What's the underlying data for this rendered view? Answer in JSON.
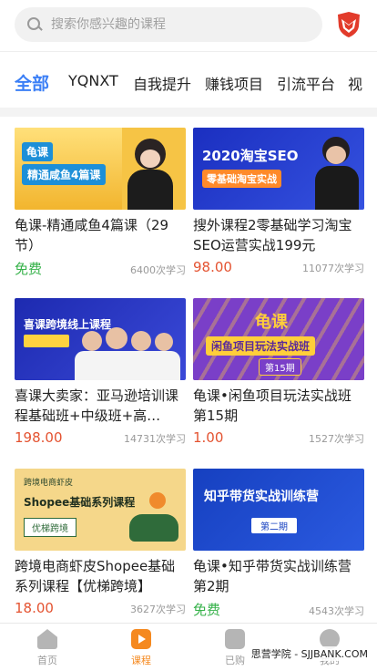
{
  "search": {
    "placeholder": "搜索你感兴趣的课程"
  },
  "tabs": [
    {
      "label": "全部"
    },
    {
      "label": "YQNXT"
    },
    {
      "label": "自我提升"
    },
    {
      "label": "赚钱项目"
    },
    {
      "label": "引流平台"
    },
    {
      "label": "视"
    }
  ],
  "courses": [
    {
      "title": "龟课-精通咸鱼4篇课（29节）",
      "price": "免费",
      "learners": "6400次学习",
      "thumb": {
        "text": "精通咸鱼4篇课",
        "tag": "龟课",
        "bg": "#f6c445",
        "accent": "#1d8fd8"
      }
    },
    {
      "title": "搜外课程2零基础学习淘宝SEO运营实战199元",
      "price": "98.00",
      "learners": "11077次学习",
      "thumb": {
        "text": "2020淘宝SEO",
        "sub": "零基础淘宝实战",
        "bg": "#1a3fc6",
        "accent": "#ff8a2a"
      }
    },
    {
      "title": "喜课大卖家：亚马逊培训课程基础班+中级班+高…",
      "price": "198.00",
      "learners": "14731次学习",
      "thumb": {
        "text": "喜课跨境线上课程",
        "bg": "#2430b8",
        "accent": "#ffd23f"
      }
    },
    {
      "title": "龟课•闲鱼项目玩法实战班第15期",
      "price": "1.00",
      "learners": "1527次学习",
      "thumb": {
        "text": "龟课",
        "sub": "闲鱼项目玩法实战班",
        "tag": "第15期",
        "bg": "#7a3fc8",
        "accent": "#ffce3a"
      }
    },
    {
      "title": "跨境电商虾皮Shopee基础系列课程【优梯跨境】",
      "price": "18.00",
      "learners": "3627次学习",
      "thumb": {
        "text": "Shopee基础系列课程",
        "sub": "优梯跨境",
        "top": "跨境电商虾皮",
        "bg": "#f5d78a",
        "accent": "#2f6b3a"
      }
    },
    {
      "title": "龟课•知乎带货实战训练营第2期",
      "price": "免费",
      "learners": "4543次学习",
      "thumb": {
        "text": "知乎带货实战训练营",
        "tag": "第二期",
        "bg": "#1a46c9",
        "accent": "#ffffff"
      }
    }
  ],
  "tabbar": [
    {
      "label": "首页"
    },
    {
      "label": "课程"
    },
    {
      "label": "已购"
    },
    {
      "label": "我的"
    }
  ],
  "watermark": "思营学院 - SJJBANK.COM",
  "colors": {
    "accent": "#3b7ff6",
    "price": "#e45331",
    "free": "#36b24a",
    "active_tab": "#f5891f"
  }
}
